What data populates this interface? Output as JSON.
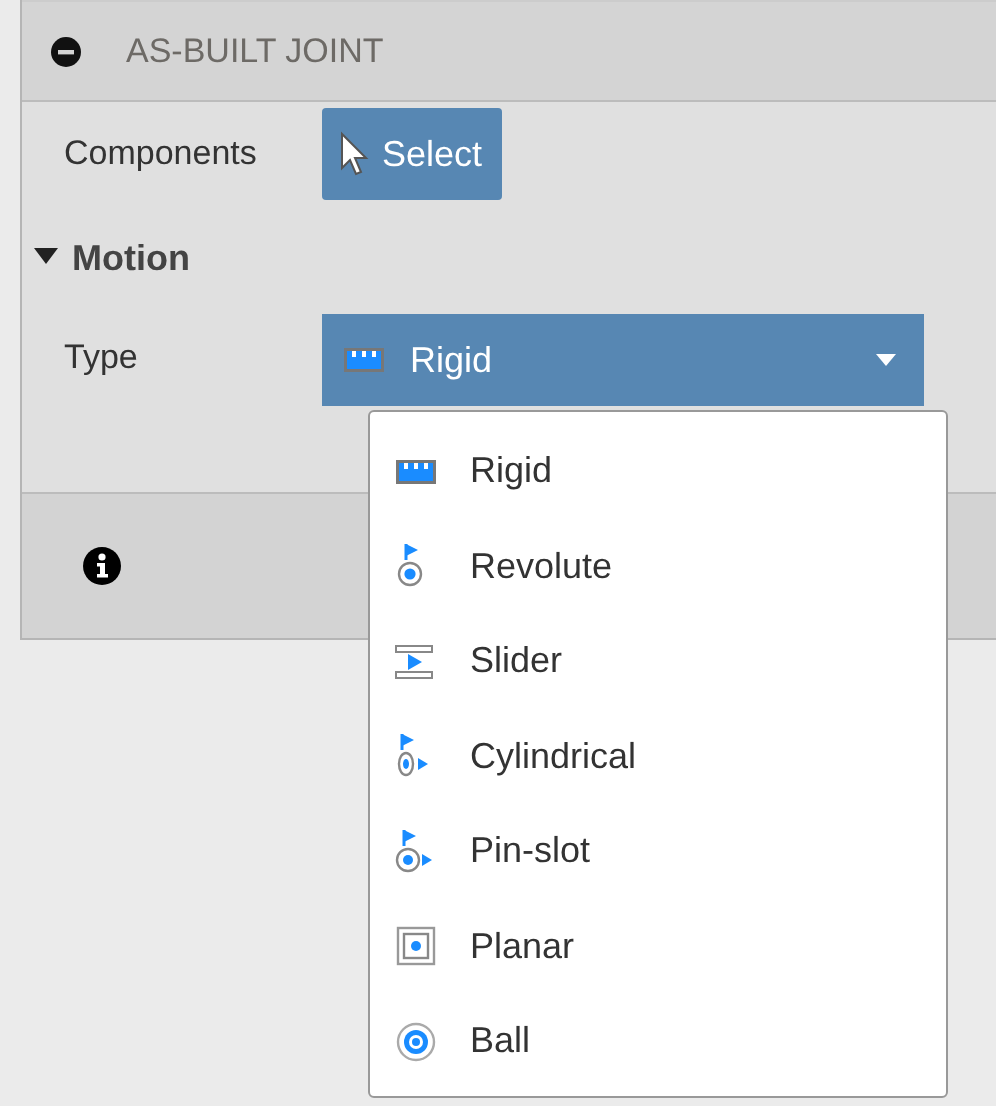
{
  "panel": {
    "title": "AS-BUILT JOINT"
  },
  "components": {
    "label": "Components",
    "button": "Select"
  },
  "motion": {
    "label": "Motion",
    "expanded": true
  },
  "type": {
    "label": "Type",
    "value": "Rigid",
    "kind": "rigid"
  },
  "menu": {
    "items": [
      {
        "label": "Rigid",
        "kind": "rigid"
      },
      {
        "label": "Revolute",
        "kind": "revolute"
      },
      {
        "label": "Slider",
        "kind": "slider"
      },
      {
        "label": "Cylindrical",
        "kind": "cylindrical"
      },
      {
        "label": "Pin-slot",
        "kind": "pin-slot"
      },
      {
        "label": "Planar",
        "kind": "planar"
      },
      {
        "label": "Ball",
        "kind": "ball"
      }
    ]
  }
}
